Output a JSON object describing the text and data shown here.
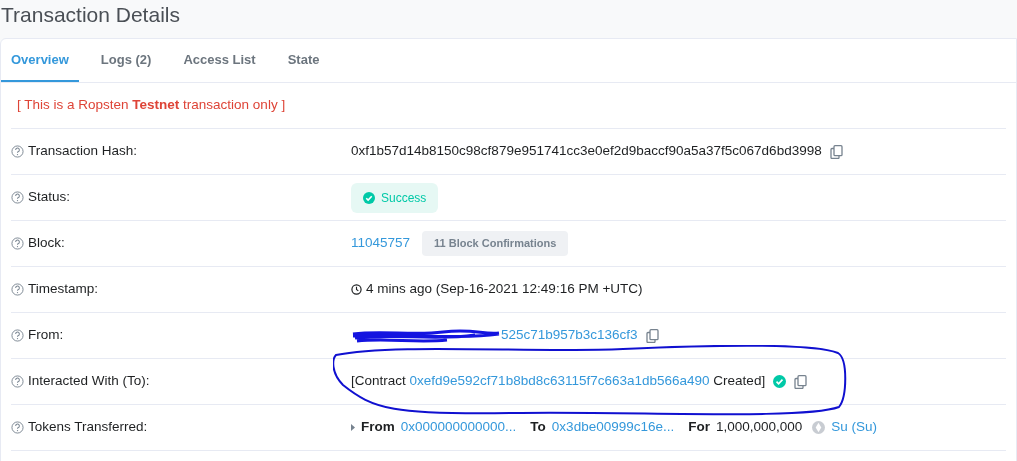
{
  "page_title": "Transaction Details",
  "tabs": [
    {
      "label": "Overview",
      "selected": true
    },
    {
      "label": "Logs (2)",
      "selected": false
    },
    {
      "label": "Access List",
      "selected": false
    },
    {
      "label": "State",
      "selected": false
    }
  ],
  "notice": "[ This is a Ropsten **Testnet** transaction only ]",
  "rows": [
    {
      "kind": "hash",
      "label": "Transaction Hash:",
      "value": "0xf1b57d14b8150c98cf879e951741cc3e0ef2d9baccf90a5a37f5c067d6bd3998"
    },
    {
      "kind": "status",
      "label": "Status:",
      "value": "Success"
    },
    {
      "kind": "block",
      "label": "Block:",
      "value": "11045757",
      "badge": "11 Block Confirmations"
    },
    {
      "kind": "timestamp",
      "label": "Timestamp:",
      "value": "4 mins ago (Sep-16-2021 12:49:16 PM +UTC)"
    },
    {
      "kind": "address",
      "label": "From:",
      "value": "525c71b957b3c136cf3",
      "redacted": true
    },
    {
      "kind": "contract",
      "label": "Interacted With (To):",
      "prefix": "[Contract",
      "address": "0xefd9e592cf71b8bd8c63115f7c663a1db566a490",
      "suffix": "Created]",
      "circled": true
    },
    {
      "kind": "tokens",
      "label": "Tokens Transferred:",
      "from_label": "From",
      "from": "0x000000000000...",
      "to_label": "To",
      "to": "0x3dbe00999c16e...",
      "for_label": "For",
      "amount": "1,000,000,000",
      "token": "Su (Su)"
    }
  ]
}
